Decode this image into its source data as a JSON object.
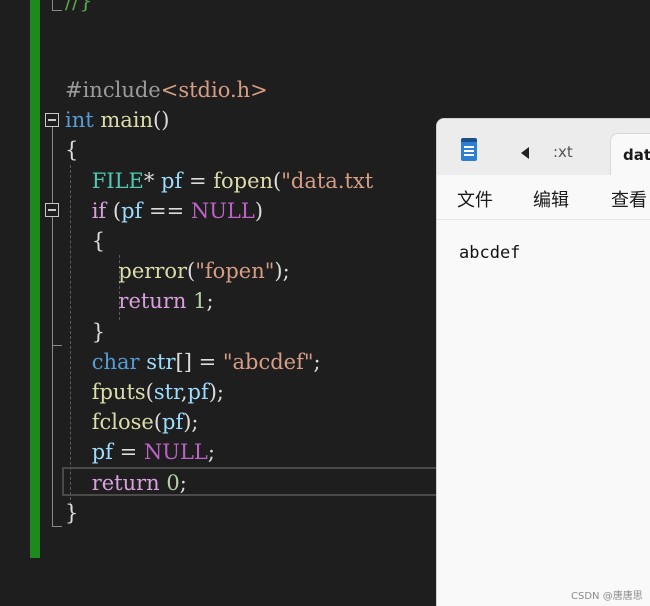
{
  "editor": {
    "top_fragment": "//}",
    "lines": [
      {
        "tokens": [
          {
            "t": "#include",
            "c": "pre"
          },
          {
            "t": "<stdio.h>",
            "c": "str"
          }
        ]
      },
      {
        "tokens": [
          {
            "t": "int ",
            "c": "kw"
          },
          {
            "t": "main",
            "c": "fn"
          },
          {
            "t": "()",
            "c": ""
          }
        ]
      },
      {
        "tokens": [
          {
            "t": "{",
            "c": ""
          }
        ]
      },
      {
        "tokens": [
          {
            "t": "    ",
            "c": ""
          },
          {
            "t": "FILE",
            "c": "ty"
          },
          {
            "t": "* ",
            "c": ""
          },
          {
            "t": "pf",
            "c": "var"
          },
          {
            "t": " = ",
            "c": ""
          },
          {
            "t": "fopen",
            "c": "fn"
          },
          {
            "t": "(",
            "c": ""
          },
          {
            "t": "\"data.txt",
            "c": "str"
          }
        ]
      },
      {
        "tokens": [
          {
            "t": "    ",
            "c": ""
          },
          {
            "t": "if",
            "c": "kw2"
          },
          {
            "t": " (",
            "c": ""
          },
          {
            "t": "pf",
            "c": "var"
          },
          {
            "t": " == ",
            "c": ""
          },
          {
            "t": "NULL",
            "c": "mac"
          },
          {
            "t": ")",
            "c": ""
          }
        ]
      },
      {
        "tokens": [
          {
            "t": "    {",
            "c": ""
          }
        ]
      },
      {
        "tokens": [
          {
            "t": "        ",
            "c": ""
          },
          {
            "t": "perror",
            "c": "fn"
          },
          {
            "t": "(",
            "c": ""
          },
          {
            "t": "\"fopen\"",
            "c": "str"
          },
          {
            "t": ");",
            "c": ""
          }
        ]
      },
      {
        "tokens": [
          {
            "t": "        ",
            "c": ""
          },
          {
            "t": "return",
            "c": "kw2"
          },
          {
            "t": " ",
            "c": ""
          },
          {
            "t": "1",
            "c": "num"
          },
          {
            "t": ";",
            "c": ""
          }
        ]
      },
      {
        "tokens": [
          {
            "t": "    }",
            "c": ""
          }
        ]
      },
      {
        "tokens": [
          {
            "t": "    ",
            "c": ""
          },
          {
            "t": "char",
            "c": "kw"
          },
          {
            "t": " ",
            "c": ""
          },
          {
            "t": "str",
            "c": "var"
          },
          {
            "t": "[] = ",
            "c": ""
          },
          {
            "t": "\"abcdef\"",
            "c": "str"
          },
          {
            "t": ";",
            "c": ""
          }
        ]
      },
      {
        "tokens": [
          {
            "t": "    ",
            "c": ""
          },
          {
            "t": "fputs",
            "c": "fn"
          },
          {
            "t": "(",
            "c": ""
          },
          {
            "t": "str",
            "c": "var"
          },
          {
            "t": ",",
            "c": ""
          },
          {
            "t": "pf",
            "c": "var"
          },
          {
            "t": ");",
            "c": ""
          }
        ]
      },
      {
        "tokens": [
          {
            "t": "    ",
            "c": ""
          },
          {
            "t": "fclose",
            "c": "fn"
          },
          {
            "t": "(",
            "c": ""
          },
          {
            "t": "pf",
            "c": "var"
          },
          {
            "t": ");",
            "c": ""
          }
        ]
      },
      {
        "tokens": [
          {
            "t": "    ",
            "c": ""
          },
          {
            "t": "pf",
            "c": "var"
          },
          {
            "t": " = ",
            "c": ""
          },
          {
            "t": "NULL",
            "c": "mac"
          },
          {
            "t": ";",
            "c": ""
          }
        ]
      },
      {
        "tokens": [
          {
            "t": "    ",
            "c": ""
          },
          {
            "t": "return",
            "c": "kw2"
          },
          {
            "t": " ",
            "c": ""
          },
          {
            "t": "0",
            "c": "num"
          },
          {
            "t": ";",
            "c": ""
          }
        ]
      },
      {
        "tokens": [
          {
            "t": "}",
            "c": ""
          }
        ]
      }
    ]
  },
  "notepad": {
    "tab_inactive_label": ":xt",
    "tab_active_label": "data",
    "menu": [
      "文件",
      "编辑",
      "查看"
    ],
    "content": "abcdef",
    "icon": "notepad-icon",
    "back_icon": "chevron-left-icon"
  },
  "watermark": "CSDN @唐唐思",
  "colors": {
    "editor_bg": "#1e1e1e",
    "change_bar": "#1e8a1e",
    "notepad_bg": "#f9f9f9"
  }
}
